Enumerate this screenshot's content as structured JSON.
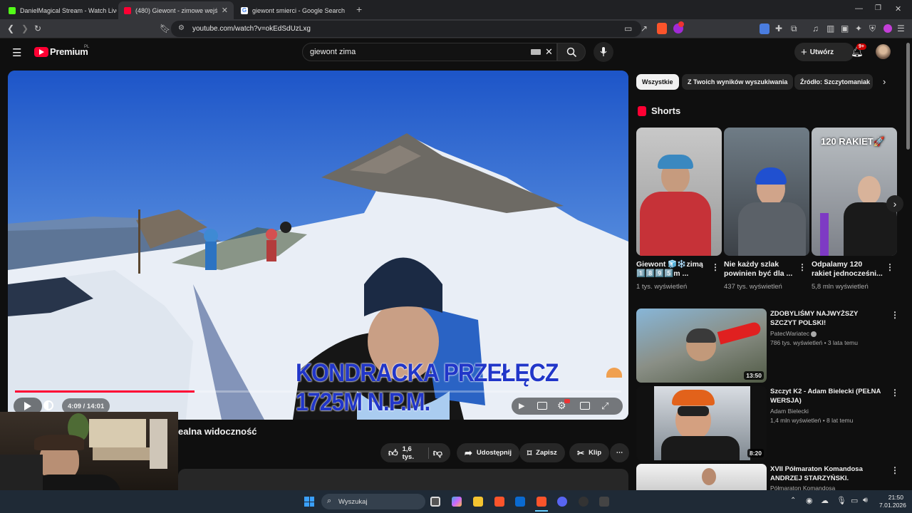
{
  "browser": {
    "tabs": [
      {
        "title": "DanielMagical Stream - Watch Live o",
        "active": false,
        "favicon_color": "#53fc18"
      },
      {
        "title": "(480) Giewont - zimowe wejście",
        "active": true,
        "favicon_color": "#ff0033"
      },
      {
        "title": "giewont smierci - Google Search",
        "active": false,
        "favicon_color": "#4285f4"
      }
    ],
    "new_tab": "+",
    "url": "youtube.com/watch?v=okEdSdUzLxg",
    "window_controls": [
      "—",
      "❐",
      "✕"
    ]
  },
  "youtube": {
    "logo_text": "Premium",
    "logo_badge": "PL",
    "search_value": "giewont zima",
    "create_label": "Utwórz",
    "notif_count": "9+"
  },
  "video": {
    "overlay_caption": "KONDRACKA PRZEŁĘCZ 1725M N.P.M.",
    "time": "4:09 / 14:01",
    "progress": 0.296,
    "title_visible": "ealna widoczność",
    "likes": "1,6 tys.",
    "share_label": "Udostępnij",
    "save_label": "Zapisz",
    "clip_label": "Klip"
  },
  "chips": [
    "Wszystkie",
    "Z Twoich wyników wyszukiwania",
    "Źródło: Szczytomaniak"
  ],
  "shorts": {
    "heading": "Shorts",
    "items": [
      {
        "title": "Giewont 🧊❄️zimą 1️⃣8️⃣9️⃣5️⃣m ...",
        "views": "1 tys. wyświetleń"
      },
      {
        "title": "Nie każdy szlak powinien być dla ...",
        "views": "437 tys. wyświetleń"
      },
      {
        "title": "Odpalamy 120 rakiet jednocześni...",
        "views": "5,8 mln wyświetleń",
        "thumb_text": "120 RAKIET🚀"
      }
    ]
  },
  "related": [
    {
      "title": "ZDOBYLIŚMY NAJWYŻSZY SZCZYT POLSKI!",
      "channel": "PatecWariatec",
      "verified": true,
      "meta": "786 tys. wyświetleń • 3 lata temu",
      "duration": "13:50"
    },
    {
      "title": "Szczyt K2 - Adam Bielecki (PEŁNA WERSJA)",
      "channel": "Adam Bielecki",
      "meta": "1,4 mln wyświetleń • 8 lat temu",
      "duration": "8:20"
    },
    {
      "title": "XVII Półmaraton Komandosa ANDRZEJ STARZYŃSKI.",
      "channel": "Półmaraton Komandosa",
      "meta": "",
      "duration": ""
    }
  ],
  "taskbar": {
    "search_placeholder": "Wyszukaj",
    "time": "21:50",
    "date": "7.01.2026"
  },
  "colors": {
    "accent_red": "#ff0033",
    "chip_active_bg": "#f1f1f1",
    "taskbar_bg": "#1f2a36"
  }
}
